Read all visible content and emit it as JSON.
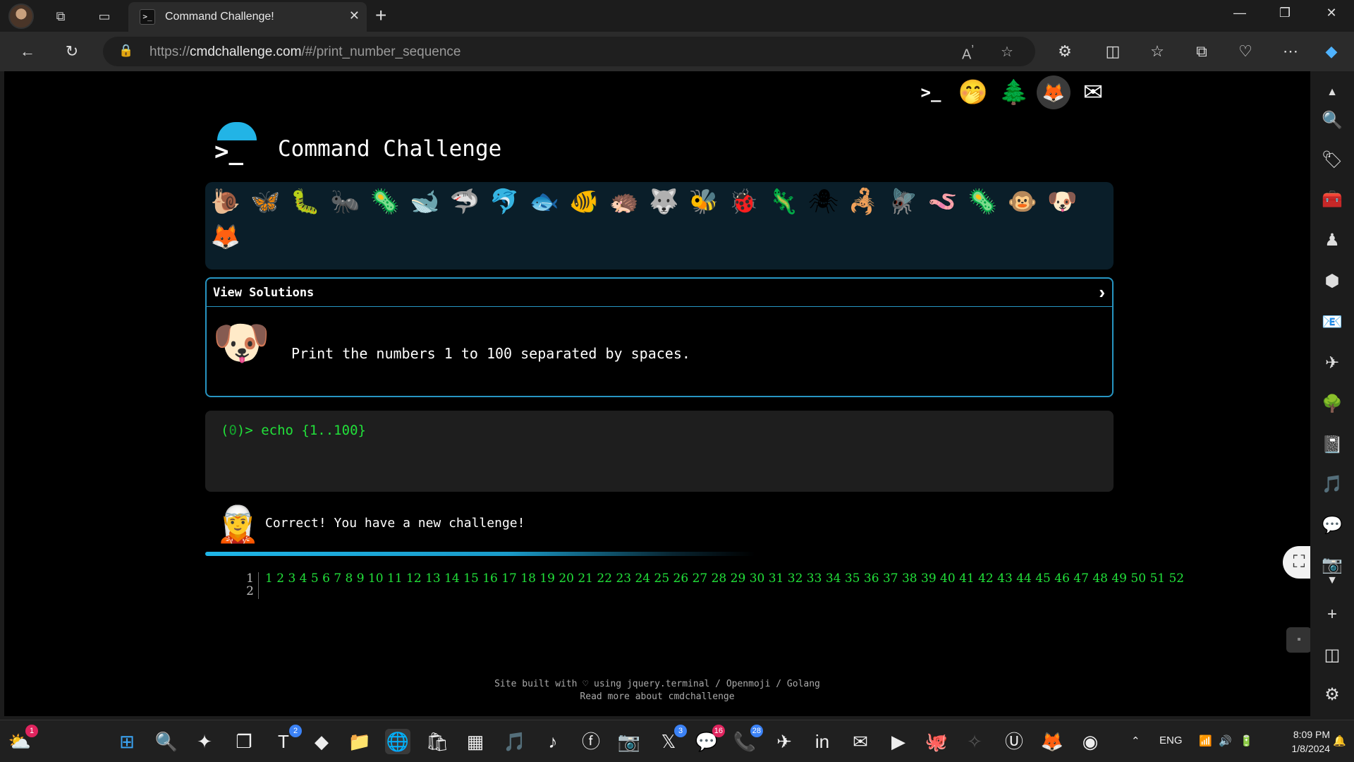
{
  "browser": {
    "tab_title": "Command Challenge!",
    "tab_favicon": ">_",
    "url_prefix": "https://",
    "url_host": "cmdchallenge.com",
    "url_path": "/#/print_number_sequence"
  },
  "header": {
    "site_title": "Command Challenge",
    "logo_prompt": ">_",
    "top_icons": [
      "terminal-logo-icon",
      "hand-over-mouth-face-icon",
      "pine-tree-icon",
      "gitlab-icon",
      "envelope-icon"
    ]
  },
  "animals": [
    "snail",
    "butterfly",
    "caterpillar",
    "ant",
    "microbe",
    "whale",
    "shark",
    "dolphin",
    "fish",
    "tropical-fish",
    "hedgehog",
    "wolf",
    "bee",
    "ladybug",
    "lizard",
    "spider",
    "scorpion",
    "fly",
    "worm",
    "paramecium",
    "monkey",
    "dog",
    "fox"
  ],
  "animal_glyphs": [
    "🐌",
    "🦋",
    "🐛",
    "🐜",
    "🦠",
    "🐋",
    "🦈",
    "🐬",
    "🐟",
    "🐠",
    "🦔",
    "🐺",
    "🐝",
    "🐞",
    "🦎",
    "🕷",
    "🦂",
    "🪰",
    "🪱",
    "🦠",
    "🐵",
    "🐶",
    "🦊"
  ],
  "solutions": {
    "header": "View Solutions",
    "challenge_text": "Print the numbers 1 to 100 separated by spaces."
  },
  "terminal": {
    "prompt_open": "(",
    "prompt_count": "0",
    "prompt_close": ")> ",
    "command": "echo {1..100}"
  },
  "result": {
    "message": "Correct! You have a new challenge!"
  },
  "output": {
    "line_numbers": [
      "1",
      "2"
    ],
    "line1": "1 2 3 4 5 6 7 8 9 10 11 12 13 14 15 16 17 18 19 20 21 22 23 24 25 26 27 28 29 30 31 32 33 34 35 36 37 38 39 40 41 42 43 44 45 46 47 48 49 50 51 52"
  },
  "footer": {
    "line1": "Site built with ♡ using jquery.terminal / Openmoji / Golang",
    "line2": "Read more about cmdchallenge"
  },
  "taskbar": {
    "badges": {
      "teams": "2",
      "twitter": "3",
      "messenger": "16",
      "whatsapp": "28",
      "weather": "1"
    },
    "language": "ENG",
    "time": "8:09 PM",
    "date": "1/8/2024"
  },
  "colors": {
    "accent": "#2795c2",
    "terminal_green": "#22e03a",
    "page_bg": "#000000",
    "panel_bg": "#0a1e29"
  }
}
